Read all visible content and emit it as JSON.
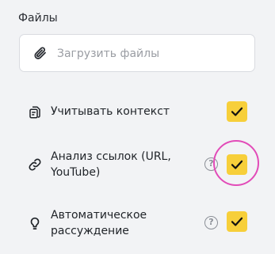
{
  "files_section": {
    "label": "Файлы",
    "upload_placeholder": "Загрузить файлы",
    "upload_icon": "paperclip-icon"
  },
  "options": [
    {
      "id": "context",
      "icon": "document-icon",
      "label_lines": [
        "Учитывать контекст"
      ],
      "has_help": false,
      "checked": true
    },
    {
      "id": "link-analysis",
      "icon": "link-icon",
      "label_lines": [
        "Анализ ссылок (URL,",
        "YouTube)"
      ],
      "has_help": true,
      "help_symbol": "?",
      "checked": true,
      "highlighted": true
    },
    {
      "id": "reasoning",
      "icon": "lightbulb-icon",
      "label_lines": [
        "Автоматическое",
        "рассуждение"
      ],
      "has_help": true,
      "help_symbol": "?",
      "checked": true
    }
  ],
  "colors": {
    "background": "#f2f3f5",
    "checkbox_fill": "#f7cf3a",
    "highlight_ring": "#e24bb8",
    "placeholder_text": "#9a9da3"
  }
}
